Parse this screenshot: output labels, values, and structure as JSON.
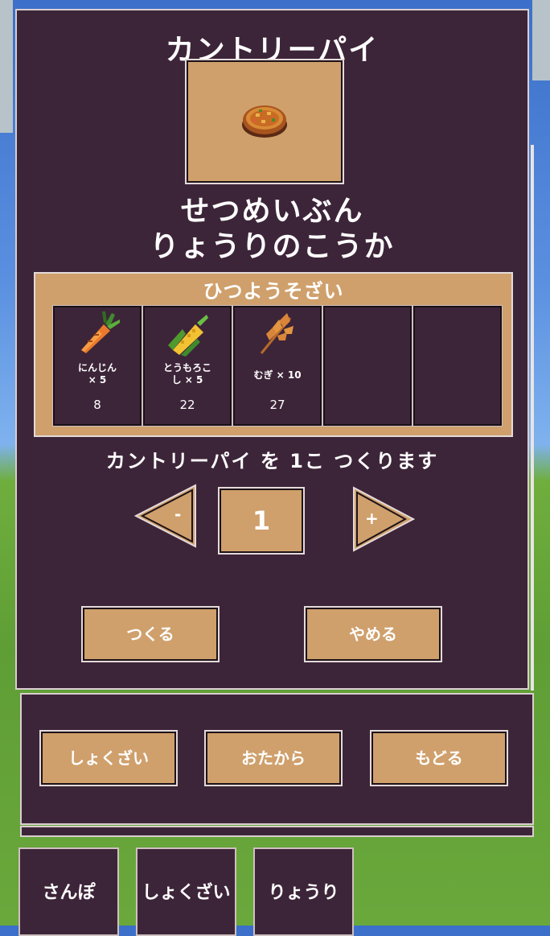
{
  "recipe": {
    "title": "カントリーパイ",
    "icon": "pie-icon",
    "description_line1": "せつめいぶん",
    "description_line2": "りょうりのこうか"
  },
  "materials": {
    "title": "ひつようそざい",
    "slots": [
      {
        "icon": "carrot-icon",
        "name": "にんじん\n× 5",
        "qty": "8"
      },
      {
        "icon": "corn-icon",
        "name": "とうもろこ\nし × 5",
        "qty": "22"
      },
      {
        "icon": "wheat-icon",
        "name": "むぎ × 10",
        "qty": "27"
      },
      {
        "icon": "",
        "name": "",
        "qty": ""
      },
      {
        "icon": "",
        "name": "",
        "qty": ""
      }
    ]
  },
  "craft": {
    "message": "カントリーパイ を 1こ つくります",
    "minus_label": "-",
    "plus_label": "+",
    "count": "1",
    "make_label": "つくる",
    "cancel_label": "やめる"
  },
  "nav": {
    "ingredients_label": "しょくざい",
    "treasure_label": "おたから",
    "back_label": "もどる"
  },
  "tabs": {
    "walk_label": "さんぽ",
    "ingredients_label": "しょくざい",
    "cooking_label": "りょうり"
  },
  "colors": {
    "panel": "#3d2539",
    "tan": "#cfa06c",
    "border": "#e4dada"
  }
}
